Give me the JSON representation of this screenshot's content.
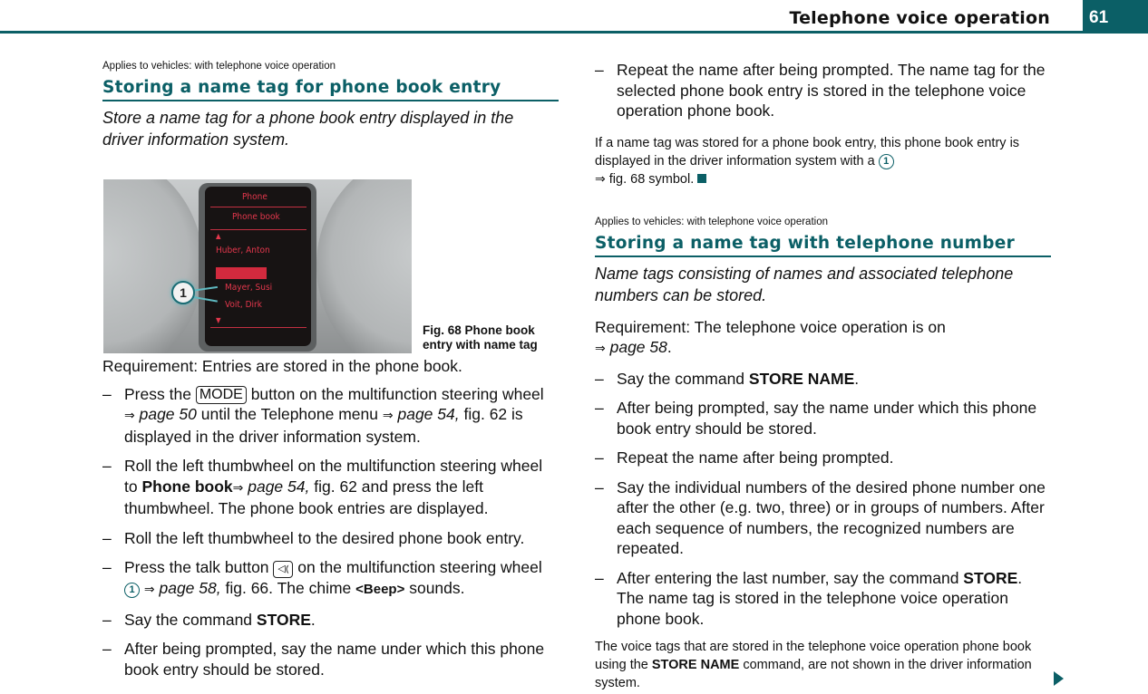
{
  "header": {
    "running_title": "Telephone voice operation",
    "page_number": "61",
    "accent_color": "#0b5f66"
  },
  "left": {
    "applies": "Applies to vehicles: with telephone voice operation",
    "title": "Storing a name tag for phone book entry",
    "intro": "Store a name tag for a phone book entry displayed in the driver information system.",
    "figure": {
      "display_lines": [
        "Phone",
        "Phone book",
        "Huber, Anton",
        "Mayer, Susi",
        "Voit, Dirk"
      ],
      "callout": "1",
      "caption": "Fig. 68   Phone book entry with name tag"
    },
    "requirement": "Requirement: Entries are stored in the phone book.",
    "steps": [
      {
        "a": "Press the",
        "key": "MODE",
        "b": "button on the multifunction steering wheel",
        "arrow": "⇒",
        "ref1": "page 50",
        "c": "until the Telephone menu",
        "ref2": "page 54,",
        "d": "fig. 62 is displayed in the driver information system."
      },
      {
        "a": "Roll the left thumbwheel on the multifunction steering wheel to",
        "bold": "Phone book",
        "ref": "page 54,",
        "b": "fig. 62 and press the left thumbwheel. The phone book entries are displayed."
      },
      {
        "text": "Roll the left thumbwheel to the desired phone book entry."
      },
      {
        "a": "Press the talk button",
        "talk_icon": "talk-button-icon",
        "b": "on the multifunction steering wheel",
        "circled": "1",
        "ref": "page 58,",
        "c": "fig. 66. The chime",
        "bold": "<Beep>",
        "d": "sounds."
      },
      {
        "a": "Say the command",
        "bold": "STORE",
        "b": "."
      },
      {
        "text": "After being prompted, say the name under which this phone book entry should be stored."
      }
    ]
  },
  "right": {
    "step_top": "Repeat the name after being prompted. The name tag for the selected phone book entry is stored in the telephone voice operation phone book.",
    "note": {
      "a": "If a name tag was stored for a phone book entry, this phone book entry is displayed in the driver information system with a",
      "circled": "1",
      "b": "fig. 68 symbol."
    },
    "applies": "Applies to vehicles: with telephone voice operation",
    "title": "Storing a name tag with telephone number",
    "intro": "Name tags consisting of names and associated telephone numbers can be stored.",
    "requirement": "Requirement: The telephone voice operation is on",
    "requirement_ref": "page 58",
    "steps": [
      {
        "a": "Say the command",
        "bold": "STORE NAME",
        "b": "."
      },
      {
        "text": "After being prompted, say the name under which this phone book entry should be stored."
      },
      {
        "text": "Repeat the name after being prompted."
      },
      {
        "text": "Say the individual numbers of the desired phone number one after the other (e.g. two, three) or in groups of numbers. After each sequence of numbers, the recognized numbers are repeated."
      },
      {
        "a": "After entering the last number, say the command",
        "bold": "STORE",
        "b": ". The name tag is stored in the telephone voice operation phone book."
      }
    ],
    "footnote": {
      "a": "The voice tags that are stored in the telephone voice operation phone book using the",
      "bold": "STORE NAME",
      "b": "command, are not shown in the driver information system."
    }
  }
}
